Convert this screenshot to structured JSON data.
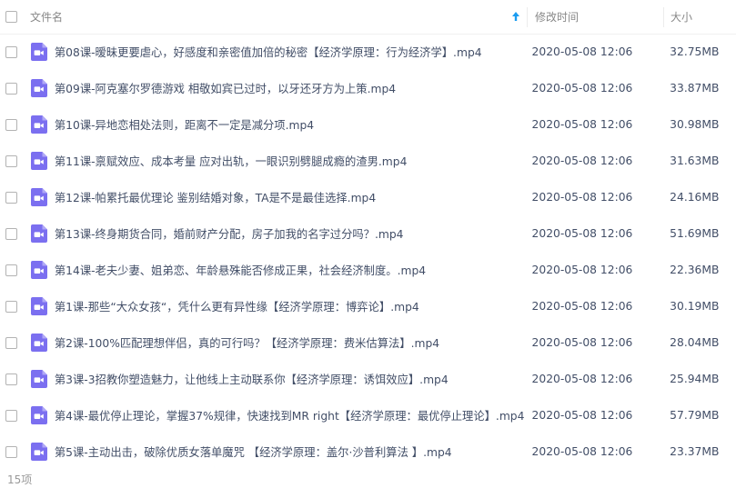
{
  "header": {
    "name_label": "文件名",
    "time_label": "修改时间",
    "size_label": "大小"
  },
  "files": [
    {
      "name": "第08课-暧昧更要虐心，好感度和亲密值加倍的秘密【经济学原理：行为经济学】.mp4",
      "time": "2020-05-08 12:06",
      "size": "32.75MB"
    },
    {
      "name": "第09课-阿克塞尔罗德游戏 相敬如宾已过时，以牙还牙方为上策.mp4",
      "time": "2020-05-08 12:06",
      "size": "33.87MB"
    },
    {
      "name": "第10课-异地恋相处法则，距离不一定是减分项.mp4",
      "time": "2020-05-08 12:06",
      "size": "30.98MB"
    },
    {
      "name": "第11课-禀赋效应、成本考量 应对出轨，一眼识别劈腿成瘾的渣男.mp4",
      "time": "2020-05-08 12:06",
      "size": "31.63MB"
    },
    {
      "name": "第12课-帕累托最优理论 鉴别结婚对象，TA是不是最佳选择.mp4",
      "time": "2020-05-08 12:06",
      "size": "24.16MB"
    },
    {
      "name": "第13课-终身期货合同，婚前财产分配，房子加我的名字过分吗？.mp4",
      "time": "2020-05-08 12:06",
      "size": "51.69MB"
    },
    {
      "name": "第14课-老夫少妻、姐弟恋、年龄悬殊能否修成正果，社会经济制度。.mp4",
      "time": "2020-05-08 12:06",
      "size": "22.36MB"
    },
    {
      "name": "第1课-那些“大众女孩“，凭什么更有异性缘【经济学原理：博弈论】.mp4",
      "time": "2020-05-08 12:06",
      "size": "30.19MB"
    },
    {
      "name": "第2课-100%匹配理想伴侣，真的可行吗？【经济学原理：费米估算法】.mp4",
      "time": "2020-05-08 12:06",
      "size": "28.04MB"
    },
    {
      "name": "第3课-3招教你塑造魅力，让他线上主动联系你【经济学原理：诱饵效应】.mp4",
      "time": "2020-05-08 12:06",
      "size": "25.94MB"
    },
    {
      "name": "第4课-最优停止理论，掌握37%规律，快速找到MR right【经济学原理：最优停止理论】.mp4",
      "time": "2020-05-08 12:06",
      "size": "57.79MB"
    },
    {
      "name": "第5课-主动出击，破除优质女落单魔咒 【经济学原理：盖尔·沙普利算法 】.mp4",
      "time": "2020-05-08 12:06",
      "size": "23.37MB"
    }
  ],
  "footer": {
    "count_label": "15项"
  },
  "colors": {
    "icon_purple": "#7b6ff0",
    "sort_arrow": "#1b9cf0",
    "text": "#424e67"
  },
  "icons": {
    "file": "video-file-icon",
    "sort": "sort-ascending-icon"
  }
}
